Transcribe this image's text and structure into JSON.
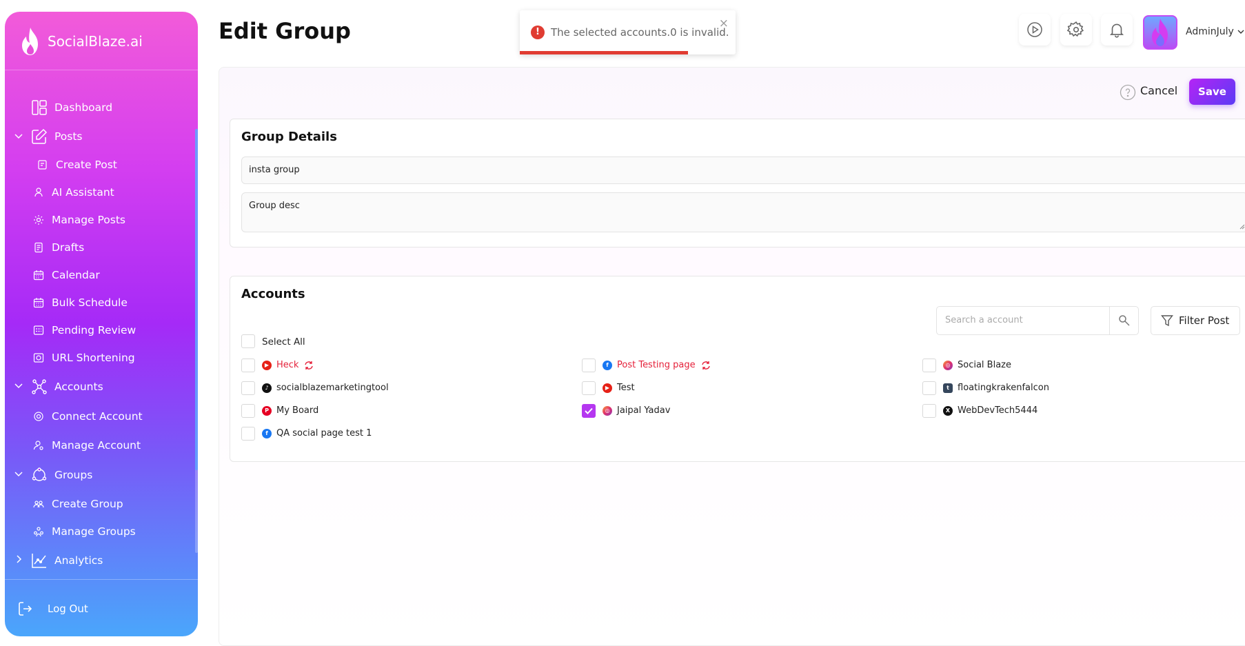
{
  "brand": {
    "name": "SocialBlaze.ai"
  },
  "sidebar": {
    "items": [
      {
        "label": "Dashboard"
      },
      {
        "label": "Posts"
      },
      {
        "label": "Create Post"
      },
      {
        "label": "AI Assistant"
      },
      {
        "label": "Manage Posts"
      },
      {
        "label": "Drafts"
      },
      {
        "label": "Calendar"
      },
      {
        "label": "Bulk Schedule"
      },
      {
        "label": "Pending Review"
      },
      {
        "label": "URL Shortening"
      },
      {
        "label": "Accounts"
      },
      {
        "label": "Connect Account"
      },
      {
        "label": "Manage Account"
      },
      {
        "label": "Groups"
      },
      {
        "label": "Create Group"
      },
      {
        "label": "Manage Groups"
      },
      {
        "label": "Analytics"
      }
    ],
    "logout": "Log Out"
  },
  "header": {
    "title": "Edit Group",
    "user": "AdminJuly"
  },
  "toast": {
    "message": "The selected accounts.0 is invalid.",
    "progress": 0.78,
    "color": "#e03c32"
  },
  "actions": {
    "cancel": "Cancel",
    "save": "Save"
  },
  "group_details": {
    "title": "Group Details",
    "name_value": "insta group",
    "desc_value": "Group desc"
  },
  "accounts": {
    "title": "Accounts",
    "search_placeholder": "Search a account",
    "filter_label": "Filter Post",
    "select_all": "Select All",
    "list": [
      {
        "name": "Heck",
        "platform": "youtube",
        "error": true,
        "checked": false
      },
      {
        "name": "Post Testing page",
        "platform": "facebook",
        "error": true,
        "checked": false
      },
      {
        "name": "Social Blaze",
        "platform": "instagram",
        "error": false,
        "checked": false
      },
      {
        "name": "socialblazemarketingtool",
        "platform": "tiktok",
        "error": false,
        "checked": false
      },
      {
        "name": "Test",
        "platform": "youtube",
        "error": false,
        "checked": false
      },
      {
        "name": "floatingkrakenfalcon",
        "platform": "tumblr",
        "error": false,
        "checked": false
      },
      {
        "name": "My Board",
        "platform": "pinterest",
        "error": false,
        "checked": false
      },
      {
        "name": "Jaipal Yadav",
        "platform": "instagram",
        "error": false,
        "checked": true
      },
      {
        "name": "WebDevTech5444",
        "platform": "x",
        "error": false,
        "checked": false
      },
      {
        "name": "QA social page test 1",
        "platform": "facebook",
        "error": false,
        "checked": false
      }
    ]
  },
  "colors": {
    "accent": "#b537f0",
    "error": "#e5213a"
  }
}
